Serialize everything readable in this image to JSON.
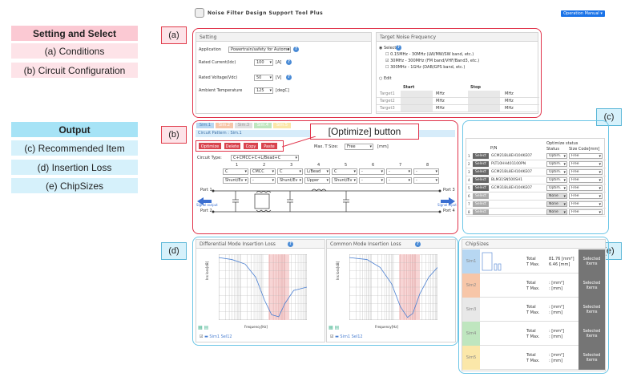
{
  "app": {
    "title": "Noise Filter Design Support Tool Plus",
    "manual": "Operation Manual ▾"
  },
  "legend": {
    "setting_head": "Setting and Select",
    "cond": "(a) Conditions",
    "circ": "(b) Circuit Configuration",
    "output_head": "Output",
    "rec": "(c) Recommended Item",
    "ins": "(d) Insertion Loss",
    "chip": "(e) ChipSizes"
  },
  "tags": {
    "a": "(a)",
    "b": "(b)",
    "c": "(c)",
    "d": "(d)",
    "e": "(e)"
  },
  "callout": "[Optimize] button",
  "setting": {
    "title": "Setting",
    "app_label": "Application",
    "app_val": "Powertrain/safety for Automotive",
    "cur_label": "Rated Current(Idc)",
    "cur_val": "100",
    "cur_unit": "[A]",
    "volt_label": "Rated Voltage(Vdc)",
    "volt_val": "50",
    "volt_unit": "[V]",
    "temp_label": "Ambient Temperature",
    "temp_val": "125",
    "temp_unit": "[degC]"
  },
  "target": {
    "title": "Target Noise Frequency",
    "select": "Select",
    "opt1": "0.15MHz - 30MHz (LW/MW/SW band, etc.)",
    "opt2": "30MHz - 300MHz (FM band/VHF/Band3, etc.)",
    "opt3": "300MHz - 1GHz (DAB/GPS band, etc.)",
    "edit": "Edit",
    "start": "Start",
    "stop": "Stop",
    "rows": [
      "Target1",
      "Target2",
      "Target3"
    ],
    "unit": "MHz"
  },
  "circuit": {
    "tabs": [
      "Sim.1",
      "Sim.2",
      "Sim.3",
      "Sim.4",
      "Sim.5"
    ],
    "pattern": "Circuit Pattern : Sim.1",
    "btns": [
      "Optimize",
      "Delete",
      "Copy",
      "Paste"
    ],
    "max_label": "Max. T Size:",
    "max_val": "Free",
    "max_unit": "[mm]",
    "type_label": "Circuit Type:",
    "type_val": "C+CMCC+C+L/Bead+C",
    "nums": [
      "1",
      "2",
      "3",
      "4",
      "5",
      "6",
      "7",
      "8"
    ],
    "row1": [
      "C",
      "CMCC",
      "C",
      "L/Bead",
      "C",
      "-",
      "-",
      "-"
    ],
    "row2": [
      "Shunt/Ev",
      "-",
      "Shunt/Ev",
      "Upper",
      "Shunt/Ev",
      "-",
      "-",
      "-"
    ],
    "port1": "Port 1",
    "port2": "Port 2",
    "port3": "Port 3",
    "port4": "Port 4",
    "sig_out": "Signal output",
    "sig_in": "Signal input"
  },
  "rec": {
    "col_pn": "P/N",
    "col_opt": "Optimize status",
    "col_status": "Status",
    "col_size": "Size Code[mm]",
    "rows": [
      {
        "n": "1",
        "btn": "Select",
        "pn": "GCM21BL8EH104KE07",
        "st": "Optim.",
        "sz": "Free"
      },
      {
        "n": "2",
        "btn": "Select",
        "pn": "PLT10HH401100PN",
        "st": "Optim.",
        "sz": "Free"
      },
      {
        "n": "3",
        "btn": "Select",
        "pn": "GCM21BL8EH104KE07",
        "st": "Optim.",
        "sz": "Free"
      },
      {
        "n": "4",
        "btn": "Select",
        "pn": "BLM31SN500SH1",
        "st": "Optim.",
        "sz": "Free"
      },
      {
        "n": "5",
        "btn": "Select",
        "pn": "GCM31BL8EH104KE07",
        "st": "Optim.",
        "sz": "Free"
      },
      {
        "n": "6",
        "btn": "Select",
        "pn": "",
        "st": "None",
        "sz": "Free"
      },
      {
        "n": "7",
        "btn": "Select",
        "pn": "",
        "st": "None",
        "sz": "Free"
      },
      {
        "n": "8",
        "btn": "Select",
        "pn": "",
        "st": "None",
        "sz": "Free"
      }
    ]
  },
  "loss": {
    "dm": "Differential Mode Insertion Loss",
    "cm": "Common Mode Insertion Loss",
    "xlabel": "Frequency[Hz]",
    "ylabel_dm": "Ins loss[dB]",
    "ylabel_cm": "Ins loss[dB]",
    "series": "Sim1 Sel12",
    "xticks": [
      "100k",
      "1M",
      "10M",
      "100M",
      "1G"
    ]
  },
  "chips": {
    "title": "ChipSizes",
    "total": "Total",
    "tmax": "T Max.",
    "val_total": "81.76 [mm²]",
    "val_tmax": "6.46 [mm]",
    "empty_total": ": [mm²]",
    "empty_tmax": ": [mm]",
    "selected": "Selected Items",
    "sims": [
      "Sim1",
      "Sim2",
      "Sim3",
      "Sim4",
      "Sim5"
    ]
  },
  "colors": {
    "red": "#e0334a",
    "blue": "#6cc6e6",
    "accent": "#1a73e8"
  }
}
